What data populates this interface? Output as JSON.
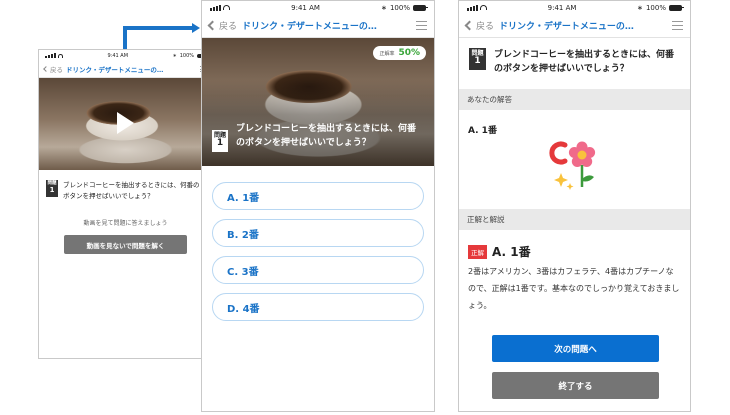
{
  "status": {
    "time": "9:41 AM",
    "battery": "100%"
  },
  "nav": {
    "back": "戻る",
    "title": "ドリンク・デザートメニューの…"
  },
  "question": {
    "badge_top": "問題",
    "badge_num": "1",
    "text_video": "ブレンドコーヒーを抽出するときには、何番のボタンを押せばいいでしょう？",
    "text_answer": "ブレンドコーヒーを抽出するときには、何番のボタンを押せばいいでしょう？"
  },
  "screen1": {
    "hint": "動画を見て問題に答えましょう",
    "skip_button": "動画を見ないで問題を解く"
  },
  "screen2": {
    "rate_label": "正解率",
    "rate_value": "50%",
    "options": [
      "A. 1番",
      "B. 2番",
      "C. 3番",
      "D. 4番"
    ]
  },
  "screen3": {
    "your_answer_header": "あなたの解答",
    "your_answer": "A. 1番",
    "explanation_header": "正解と解説",
    "correct_badge": "正解",
    "correct_answer": "A. 1番",
    "explanation": "2番はアメリカン、3番はカフェラテ、4番はカプチーノなので、正解は1番です。基本なのでしっかり覚えておきましょう。",
    "next_button": "次の問題へ",
    "end_button": "終了する"
  },
  "colors": {
    "accent": "#1a73c7",
    "button_blue": "#0a6fd0",
    "correct_red": "#e5393b",
    "rate_green": "#3aa63a"
  }
}
